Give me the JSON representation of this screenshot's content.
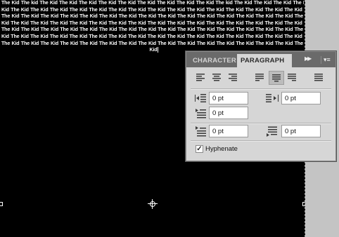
{
  "document": {
    "text_lines": [
      "The Kid The kid The Kid The Kid The Kid The Kid The Kid The Kid The Kid The Kid The Kid The kid The Kid The Kid The Kid The Kid The Kid The Kid The Kid The Kid",
      "Kid The Kid The Kid The Kid The Kid The Kid The Kid The Kid The Kid The Kid The Kid The Kid The Kid The Kid The Kid The Kid The Kid The Kid The Kid The Kid The",
      "The Kid The Kid The Kid The Kid The Kid The Kid The Kid The Kid The Kid The Kid The Kid The Kid The Kid The Kid The Kid The Kid The Kid The Kid The Kid The Kid",
      "Kid The Kid The Kid The Kid The Kid The Kid The Kid The Kid The Kid The Kid The Kid The Kid The Kid The Kid The Kid The Kid The Kid The Kid The Kid The Kid The",
      "The Kid The Kid The Kid The Kid The Kid The Kid The Kid The Kid The Kid The Kid The Kid The Kid The Kid The Kid The Kid The Kid The Kid The Kid The Kid The Kid",
      "Kid The Kid The Kid The Kid The Kid The Kid The Kid The Kid The Kid The Kid The Kid The Kid The Kid The Kid The Kid The Kid The Kid The Kid The Kid The Kid The",
      "The Kid The Kid The Kid The Kid The Kid The Kid The Kid The Kid The Kid The Kid The Kid The Kid The Kid The Kid The Kid The Kid The Kid The Kid The Kid The Kid"
    ],
    "last_line": "Kid"
  },
  "panel": {
    "tabs": [
      {
        "label": "CHARACTER",
        "active": false
      },
      {
        "label": "PARAGRAPH",
        "active": true
      }
    ],
    "collapse_icon": "double-chevron-right-icon",
    "menu_icon": "panel-menu-icon",
    "alignment_buttons": [
      "align-left-icon",
      "align-center-icon",
      "align-right-icon",
      "justify-last-left-icon",
      "justify-last-center-icon",
      "justify-last-right-icon",
      "justify-all-icon"
    ],
    "active_alignment": "justify-last-center-icon",
    "fields": {
      "indent_left": "0 pt",
      "indent_right": "0 pt",
      "indent_first_line": "0 pt",
      "space_before": "0 pt",
      "space_after": "0 pt"
    },
    "hyphenate": {
      "label": "Hyphenate",
      "checked": true,
      "check_glyph": "✓"
    }
  },
  "colors": {
    "canvas": "#000000",
    "panel_bg": "#d6d6d6",
    "tabbar": "#6a6a6a",
    "gutter": "#c4c4c4"
  }
}
